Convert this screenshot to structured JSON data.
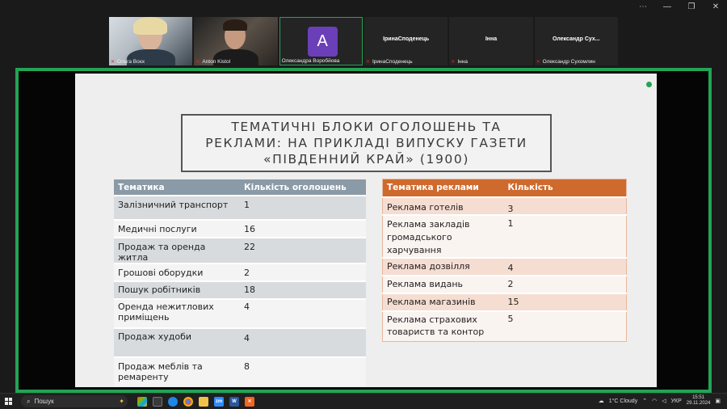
{
  "participants": [
    {
      "name": "Ольга Воєк",
      "type": "video"
    },
    {
      "name": "Anton Kistol",
      "type": "video"
    },
    {
      "name": "Олександра Воробйова",
      "type": "avatar",
      "initial": "A"
    },
    {
      "name": "IринаСподенець",
      "display": "IринаСподенець",
      "type": "name"
    },
    {
      "name": "Iнна",
      "display": "Iнна",
      "type": "name"
    },
    {
      "name": "Олександр Сухомлин",
      "display": "Олександр  Сух...",
      "type": "name"
    }
  ],
  "slide": {
    "title_lines": [
      "ТЕМАТИЧНІ БЛОКИ ОГОЛОШЕНЬ ТА",
      "РЕКЛАМИ: НА ПРИКЛАДІ ВИПУСКУ ГАЗЕТИ",
      "«ПІВДЕННИЙ КРАЙ» (1900)"
    ],
    "table1": {
      "headers": [
        "Тематика",
        "Кількість оголошень"
      ],
      "rows": [
        [
          "Залізничний транспорт",
          "1"
        ],
        [
          "Медичні послуги",
          "16"
        ],
        [
          "Продаж та оренда житла",
          "22"
        ],
        [
          "Грошові оборудки",
          "2"
        ],
        [
          "Пошук робітників",
          "18"
        ],
        [
          "Оренда нежитлових приміщень",
          "4"
        ],
        [
          "Продаж худоби",
          "4"
        ],
        [
          "Продаж меблів та ремаренту",
          "8"
        ]
      ]
    },
    "table2": {
      "headers": [
        "Тематика реклами",
        "Кількість"
      ],
      "rows": [
        [
          "Реклама готелів",
          "3"
        ],
        [
          "Реклама закладів громадського харчування",
          "1"
        ],
        [
          "Реклама дозвілля",
          "4"
        ],
        [
          "Реклама видань",
          "2"
        ],
        [
          "Реклама магазинів",
          "15"
        ],
        [
          "Реклама страхових товариств та контор",
          "5"
        ]
      ]
    }
  },
  "taskbar": {
    "search_label": "Пошук",
    "weather": "1°C  Cloudy",
    "language": "УКР",
    "time": "15:51",
    "date": "29.11.2024"
  },
  "colors": {
    "active_border": "#23a455",
    "table1_header": "#8a9aa6",
    "table2_header": "#cf6a2e"
  }
}
